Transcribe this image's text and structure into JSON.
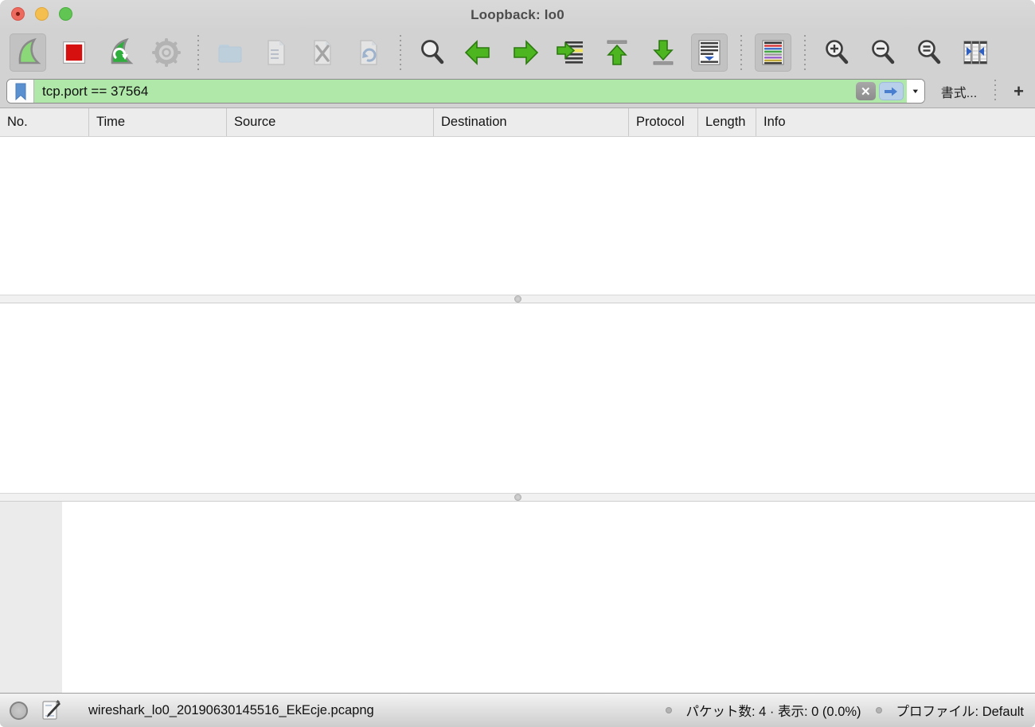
{
  "window": {
    "title": "Loopback: lo0",
    "edited_indicator": true
  },
  "titlebar_buttons": [
    "close-button",
    "minimize-button",
    "zoom-button"
  ],
  "toolbar": {
    "buttons": [
      {
        "name": "start-capture",
        "icon": "wireshark-fin-icon",
        "state": "active"
      },
      {
        "name": "stop-capture",
        "icon": "stop-square-icon",
        "state": "enabled"
      },
      {
        "name": "restart-capture",
        "icon": "fin-restart-icon",
        "state": "enabled"
      },
      {
        "name": "capture-options",
        "icon": "gear-icon",
        "state": "disabled"
      },
      {
        "name": "open-file",
        "icon": "folder-icon",
        "state": "disabled"
      },
      {
        "name": "save-file",
        "icon": "document-save-icon",
        "state": "disabled"
      },
      {
        "name": "close-file",
        "icon": "document-close-icon",
        "state": "disabled"
      },
      {
        "name": "reload-file",
        "icon": "document-reload-icon",
        "state": "disabled"
      },
      {
        "name": "find-packet",
        "icon": "magnifier-icon",
        "state": "enabled"
      },
      {
        "name": "go-back",
        "icon": "arrow-left-icon",
        "state": "enabled"
      },
      {
        "name": "go-forward",
        "icon": "arrow-right-icon",
        "state": "enabled"
      },
      {
        "name": "go-to-packet",
        "icon": "arrow-into-list-icon",
        "state": "enabled"
      },
      {
        "name": "go-first-packet",
        "icon": "arrow-top-icon",
        "state": "enabled"
      },
      {
        "name": "go-last-packet",
        "icon": "arrow-bottom-icon",
        "state": "enabled"
      },
      {
        "name": "auto-scroll",
        "icon": "autoscroll-list-icon",
        "state": "pressed"
      },
      {
        "name": "colorize",
        "icon": "colored-lines-icon",
        "state": "pressed"
      },
      {
        "name": "zoom-in",
        "icon": "magnifier-plus-icon",
        "state": "enabled"
      },
      {
        "name": "zoom-out",
        "icon": "magnifier-minus-icon",
        "state": "enabled"
      },
      {
        "name": "zoom-reset",
        "icon": "magnifier-equal-icon",
        "state": "enabled"
      },
      {
        "name": "resize-columns",
        "icon": "resize-columns-icon",
        "state": "enabled"
      }
    ]
  },
  "filter": {
    "bookmark_icon": "bookmark-icon",
    "value": "tcp.port == 37564",
    "valid_bg": "#afe8a8",
    "clear_glyph": "✕",
    "apply_icon": "blue-right-arrow-icon",
    "dropdown_glyph": "▼",
    "expression_label": "書式...",
    "add_label": "+"
  },
  "packet_list": {
    "columns": [
      "No.",
      "Time",
      "Source",
      "Destination",
      "Protocol",
      "Length",
      "Info"
    ],
    "rows": []
  },
  "statusbar": {
    "expert_icon": "expert-info-circle-icon",
    "comment_icon": "capture-comment-icon",
    "filename": "wireshark_lo0_20190630145516_EkEcje.pcapng",
    "packet_stats": "パケット数: 4 · 表示: 0 (0.0%)",
    "profile": "プロファイル: Default"
  },
  "colors": {
    "chrome_gray": "#d2d2d2",
    "filter_valid_green": "#afe8a8",
    "accent_green": "#4db520",
    "stop_red": "#d60f0f",
    "bookmark_blue": "#5a8fd0"
  }
}
